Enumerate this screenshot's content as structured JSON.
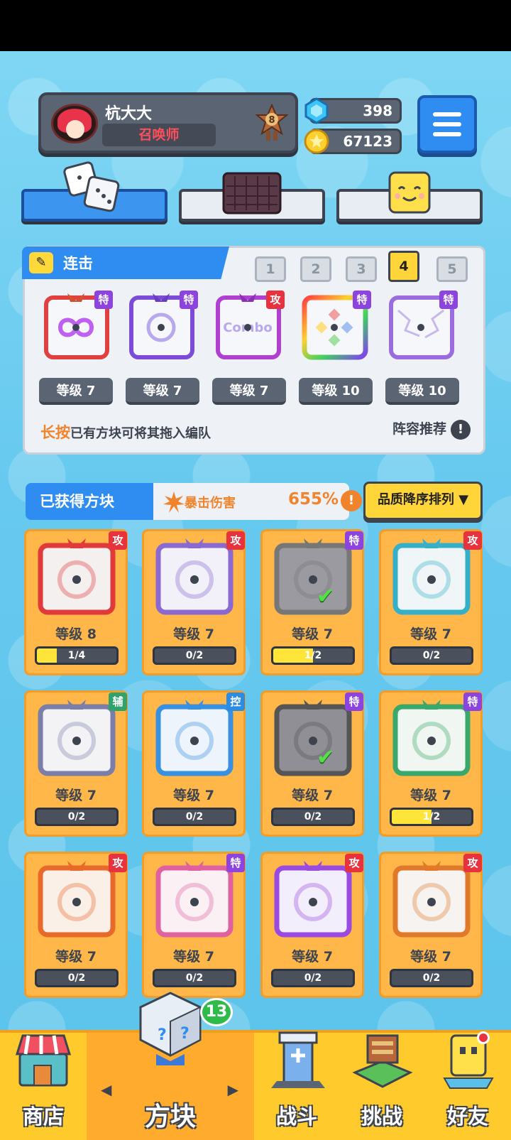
{
  "profile": {
    "name": "杭大大",
    "title": "召唤师",
    "rank": "8"
  },
  "currency": {
    "gems": "398",
    "coins": "67123"
  },
  "deck": {
    "title": "连击",
    "slots": [
      "1",
      "2",
      "3",
      "4",
      "5"
    ],
    "active_slot": "4",
    "cards": [
      {
        "tag": "特",
        "level": "等级 7"
      },
      {
        "tag": "特",
        "level": "等级 7"
      },
      {
        "tag": "攻",
        "level": "等级 7"
      },
      {
        "tag": "特",
        "level": "等级 10"
      },
      {
        "tag": "特",
        "level": "等级 10"
      }
    ],
    "hint_bold": "长按",
    "hint_text": "已有方块可将其拖入编队",
    "recommend": "阵容推荐",
    "combo_text": "Combo"
  },
  "owned": {
    "title": "已获得方块",
    "crit_label": "暴击伤害",
    "crit_value": "655%",
    "sort": "品质降序排列 ▼"
  },
  "grid": [
    {
      "tag": "攻",
      "level": "等级 8",
      "progress": "1/4",
      "fill": 0.25
    },
    {
      "tag": "攻",
      "level": "等级 7",
      "progress": "0/2",
      "fill": 0
    },
    {
      "tag": "特",
      "level": "等级 7",
      "progress": "1/2",
      "fill": 0.5
    },
    {
      "tag": "攻",
      "level": "等级 7",
      "progress": "0/2",
      "fill": 0
    },
    {
      "tag": "辅",
      "level": "等级 7",
      "progress": "0/2",
      "fill": 0
    },
    {
      "tag": "控",
      "level": "等级 7",
      "progress": "0/2",
      "fill": 0
    },
    {
      "tag": "特",
      "level": "等级 7",
      "progress": "0/2",
      "fill": 0
    },
    {
      "tag": "特",
      "level": "等级 7",
      "progress": "1/2",
      "fill": 0.5
    },
    {
      "tag": "攻",
      "level": "等级 7",
      "progress": "0/2",
      "fill": 0
    },
    {
      "tag": "特",
      "level": "等级 7",
      "progress": "0/2",
      "fill": 0
    },
    {
      "tag": "攻",
      "level": "等级 7",
      "progress": "0/2",
      "fill": 0
    },
    {
      "tag": "攻",
      "level": "等级 7",
      "progress": "0/2",
      "fill": 0
    }
  ],
  "nav": {
    "shop": "商店",
    "blocks": "方块",
    "battle": "战斗",
    "challenge": "挑战",
    "friends": "好友",
    "blocks_badge": "13"
  }
}
